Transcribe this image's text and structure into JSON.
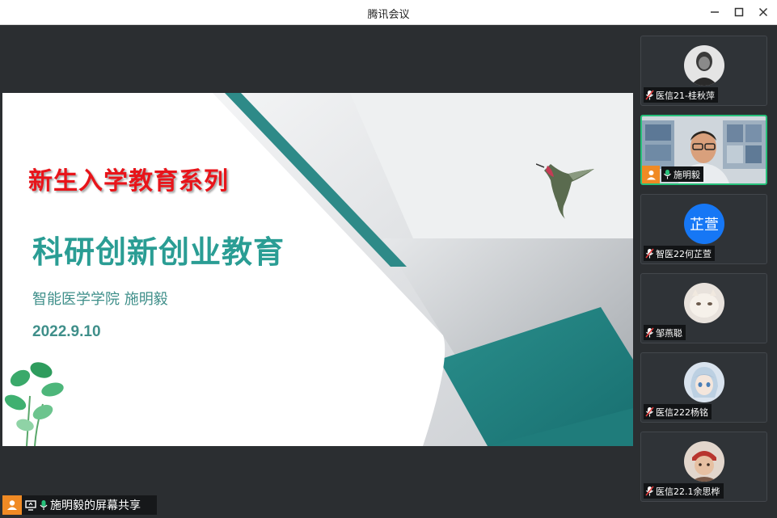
{
  "window": {
    "title": "腾讯会议"
  },
  "slide": {
    "series": "新生入学教育系列",
    "title": "科研创新创业教育",
    "author": "智能医学学院  施明毅",
    "date": "2022.9.10"
  },
  "share_bar": {
    "label": "施明毅的屏幕共享"
  },
  "participants": [
    {
      "name": "医信21-桂秋萍",
      "mic": "muted"
    },
    {
      "name": "施明毅",
      "mic": "on",
      "video": true
    },
    {
      "name": "智医22何芷萱",
      "mic": "muted",
      "avatar_text": "芷萱"
    },
    {
      "name": "邹燕聪",
      "mic": "muted"
    },
    {
      "name": "医信222杨铭",
      "mic": "muted"
    },
    {
      "name": "医信22.1余思桦",
      "mic": "muted"
    }
  ],
  "colors": {
    "accent_green": "#27c07a",
    "user_orange": "#f08a24",
    "avatar_blue": "#1677f5",
    "title_teal": "#2a9d94",
    "series_red": "#e8141a"
  }
}
